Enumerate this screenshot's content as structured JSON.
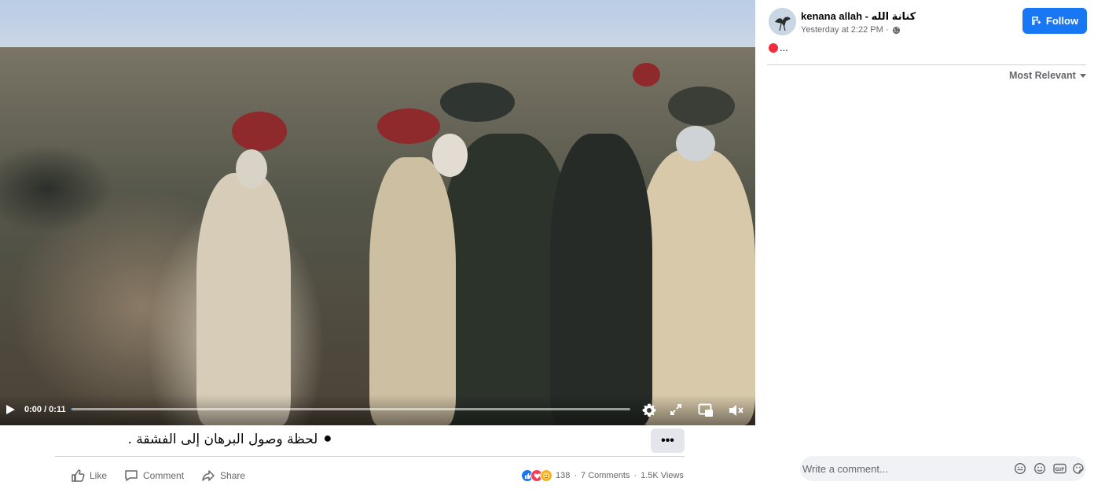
{
  "player": {
    "time": "0:00 / 0:11",
    "progress_fraction": 0.003,
    "icons": [
      "play-icon",
      "settings-icon",
      "fullscreen-icon",
      "pip-icon",
      "volume-muted-icon"
    ]
  },
  "post": {
    "caption": "⚫ لحظة وصول البرهان إلى الفشقة .",
    "more_label": "•••",
    "actions": {
      "like": "Like",
      "comment": "Comment",
      "share": "Share"
    },
    "stats": {
      "reactions": "138",
      "comments": "7 Comments",
      "views": "1.5K Views",
      "separator": "·"
    }
  },
  "panel": {
    "page_name": "kenana allah - كنانة الله",
    "time": "Yesterday at 2:22 PM ·",
    "follow_label": "Follow",
    "post_text_suffix": "...",
    "sort_label": "Most Relevant",
    "comment_placeholder": "Write a comment..."
  },
  "colors": {
    "accent": "#1877f2",
    "secondary_text": "#65676b",
    "comment_bg": "#f0f2f5",
    "red_dot": "#ef2d3c"
  }
}
